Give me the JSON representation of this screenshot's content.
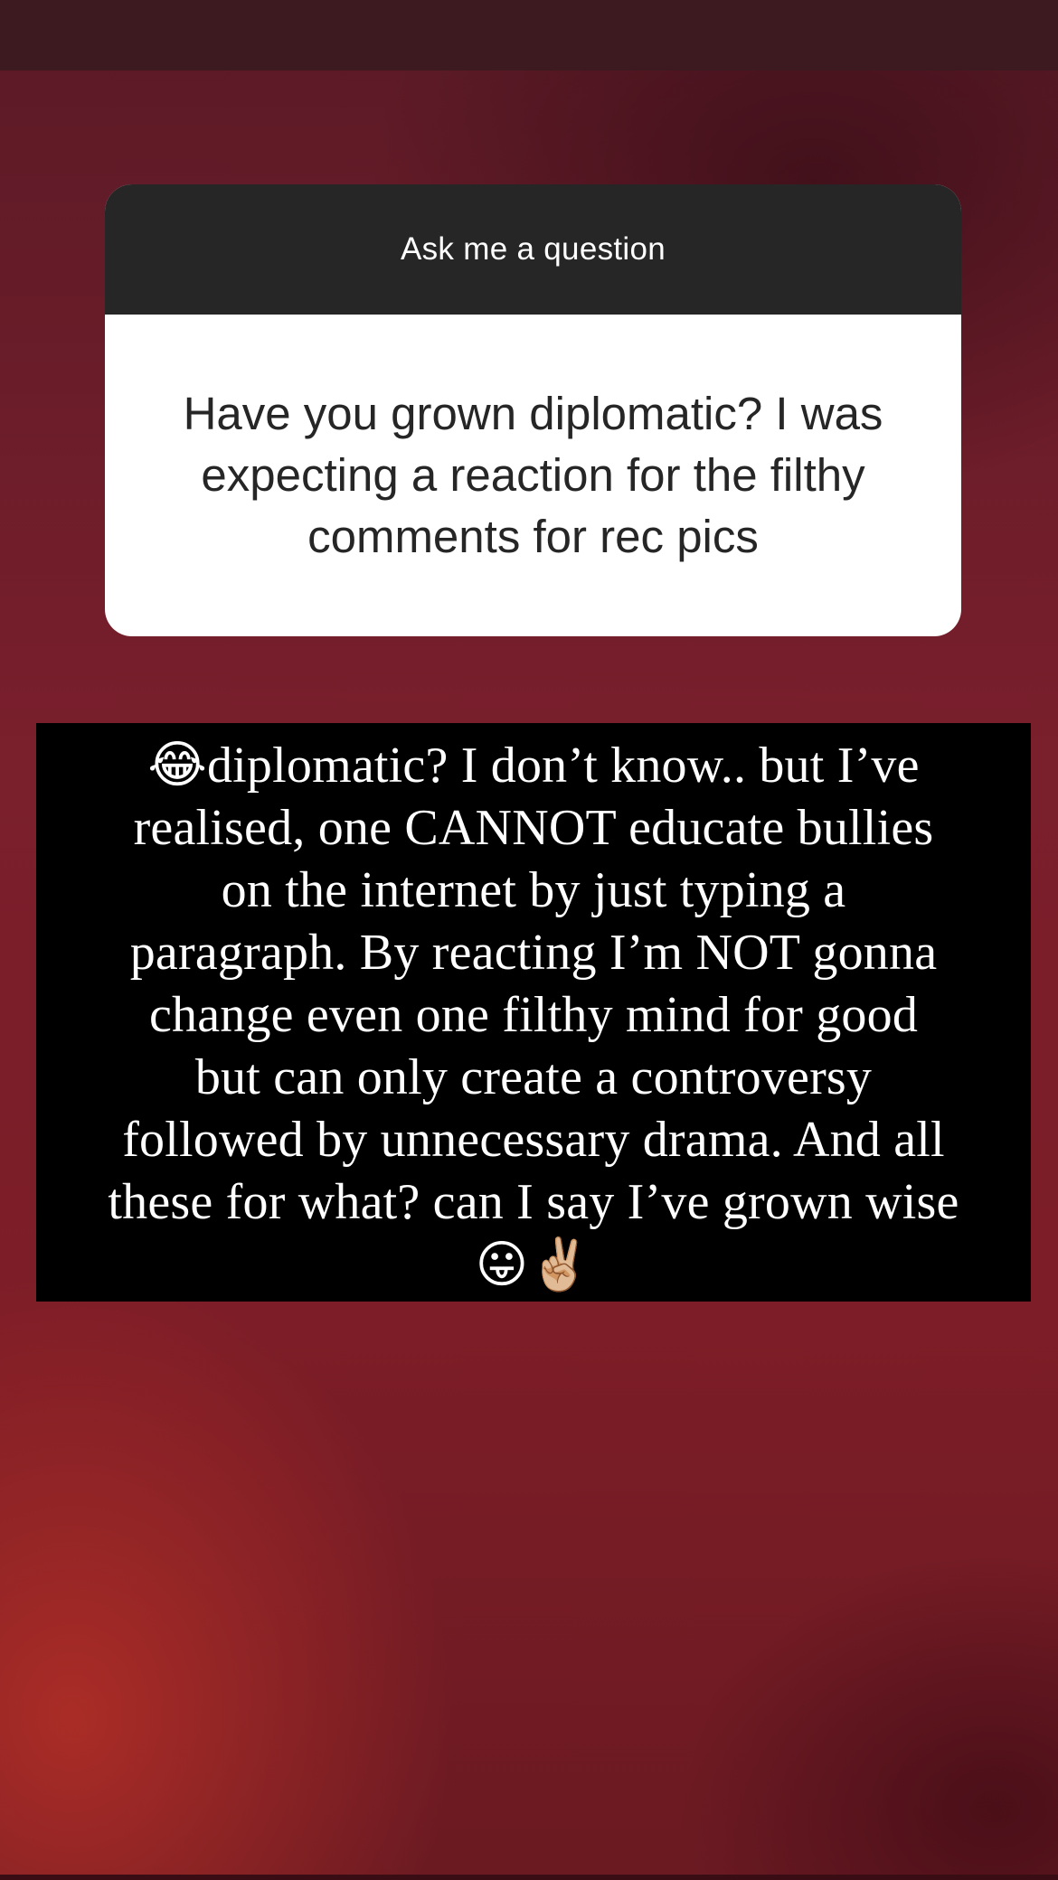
{
  "question_sticker": {
    "title": "Ask me a question",
    "question": "Have you grown diplomatic? I was expecting a reaction for the filthy comments for rec pics"
  },
  "answer": {
    "leading_emoji": "😂",
    "lines": [
      "diplomatic? I don’t know.. but I’ve",
      "realised, one CANNOT educate bullies",
      "on the internet by just typing a",
      "paragraph.  By reacting I’m NOT gonna",
      "change even one filthy mind for good",
      "but can only create a controversy",
      "followed by unnecessary drama. And all",
      "these for what? can I say I’ve grown wise"
    ],
    "trailing_emojis": "😛✌🏼"
  },
  "colors": {
    "background": "#6a1c28",
    "card_header": "#262626",
    "card_body": "#ffffff",
    "answer_box": "#000000"
  }
}
